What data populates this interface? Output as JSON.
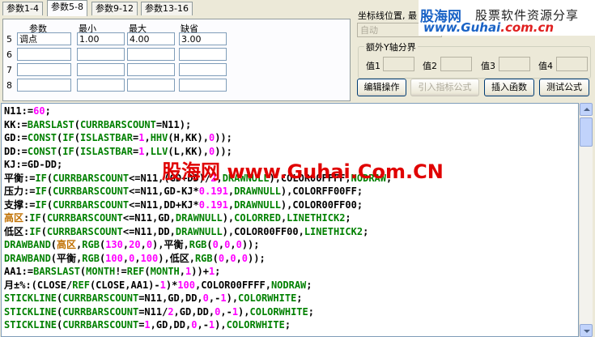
{
  "tabs": [
    "参数1-4",
    "参数5-8",
    "参数9-12",
    "参数13-16"
  ],
  "params": {
    "headers": [
      "参数",
      "最小",
      "最大",
      "缺省"
    ],
    "rows": [
      {
        "num": "5",
        "name": "调点",
        "min": "1.00",
        "max": "4.00",
        "default": "3.00"
      },
      {
        "num": "6",
        "name": "",
        "min": "",
        "max": "",
        "default": ""
      },
      {
        "num": "7",
        "name": "",
        "min": "",
        "max": "",
        "default": ""
      },
      {
        "num": "8",
        "name": "",
        "min": "",
        "max": "",
        "default": ""
      }
    ]
  },
  "coord": {
    "label": "坐标线位置, 最",
    "combo_value": "自动"
  },
  "extra_y": {
    "title": "额外Y轴分界",
    "labels": [
      "值1",
      "值2",
      "值3",
      "值4"
    ]
  },
  "buttons": {
    "edit": "编辑操作",
    "import": "引入指标公式",
    "insert": "插入函数",
    "test": "测试公式"
  },
  "logo": {
    "brand": "股海网",
    "tagline": "股票软件资源分享",
    "url_main": "www.Guhai",
    "url_suffix": ".com.cn"
  },
  "watermark": "股海网 www.Guhai.Com.CN",
  "code_lines": [
    [
      [
        "o",
        "N11:="
      ],
      [
        "n",
        "60"
      ],
      [
        "o",
        ";"
      ]
    ],
    [
      [
        "o",
        "KK:="
      ],
      [
        "k",
        "BARSLAST"
      ],
      [
        "o",
        "("
      ],
      [
        "k",
        "CURRBARSCOUNT"
      ],
      [
        "o",
        "=N11);"
      ]
    ],
    [
      [
        "o",
        "GD:="
      ],
      [
        "k",
        "CONST"
      ],
      [
        "o",
        "("
      ],
      [
        "k",
        "IF"
      ],
      [
        "o",
        "("
      ],
      [
        "k",
        "ISLASTBAR"
      ],
      [
        "o",
        "="
      ],
      [
        "n",
        "1"
      ],
      [
        "o",
        ","
      ],
      [
        "k",
        "HHV"
      ],
      [
        "o",
        "(H,KK),"
      ],
      [
        "n",
        "0"
      ],
      [
        "o",
        "));"
      ]
    ],
    [
      [
        "o",
        "DD:="
      ],
      [
        "k",
        "CONST"
      ],
      [
        "o",
        "("
      ],
      [
        "k",
        "IF"
      ],
      [
        "o",
        "("
      ],
      [
        "k",
        "ISLASTBAR"
      ],
      [
        "o",
        "="
      ],
      [
        "n",
        "1"
      ],
      [
        "o",
        ","
      ],
      [
        "k",
        "LLV"
      ],
      [
        "o",
        "(L,KK),"
      ],
      [
        "n",
        "0"
      ],
      [
        "o",
        "));"
      ]
    ],
    [
      [
        "o",
        "KJ:=GD-DD;"
      ]
    ],
    [
      [
        "o",
        "平衡:="
      ],
      [
        "k",
        "IF"
      ],
      [
        "o",
        "("
      ],
      [
        "k",
        "CURRBARSCOUNT"
      ],
      [
        "o",
        "<=N11,(GD+DD)/"
      ],
      [
        "n",
        "2"
      ],
      [
        "o",
        ","
      ],
      [
        "k",
        "DRAWNULL"
      ],
      [
        "o",
        "),COLOR00FFFF,"
      ],
      [
        "k",
        "NODRAW"
      ],
      [
        "o",
        ";"
      ]
    ],
    [
      [
        "o",
        "压力:="
      ],
      [
        "k",
        "IF"
      ],
      [
        "o",
        "("
      ],
      [
        "k",
        "CURRBARSCOUNT"
      ],
      [
        "o",
        "<=N11,GD-KJ*"
      ],
      [
        "n",
        "0.191"
      ],
      [
        "o",
        ","
      ],
      [
        "k",
        "DRAWNULL"
      ],
      [
        "o",
        "),COLORFF00FF;"
      ]
    ],
    [
      [
        "o",
        "支撑:="
      ],
      [
        "k",
        "IF"
      ],
      [
        "o",
        "("
      ],
      [
        "k",
        "CURRBARSCOUNT"
      ],
      [
        "o",
        "<=N11,DD+KJ*"
      ],
      [
        "n",
        "0.191"
      ],
      [
        "o",
        ","
      ],
      [
        "k",
        "DRAWNULL"
      ],
      [
        "o",
        "),COLOR00FF00;"
      ]
    ],
    [
      [
        "h",
        "高区"
      ],
      [
        "o",
        ":"
      ],
      [
        "k",
        "IF"
      ],
      [
        "o",
        "("
      ],
      [
        "k",
        "CURRBARSCOUNT"
      ],
      [
        "o",
        "<=N11,GD,"
      ],
      [
        "k",
        "DRAWNULL"
      ],
      [
        "o",
        "),"
      ],
      [
        "k",
        "COLORRED"
      ],
      [
        "o",
        ","
      ],
      [
        "k",
        "LINETHICK2"
      ],
      [
        "o",
        ";"
      ]
    ],
    [
      [
        "o",
        "低区:"
      ],
      [
        "k",
        "IF"
      ],
      [
        "o",
        "("
      ],
      [
        "k",
        "CURRBARSCOUNT"
      ],
      [
        "o",
        "<=N11,DD,"
      ],
      [
        "k",
        "DRAWNULL"
      ],
      [
        "o",
        "),COLOR00FF00,"
      ],
      [
        "k",
        "LINETHICK2"
      ],
      [
        "o",
        ";"
      ]
    ],
    [
      [
        "k",
        "DRAWBAND"
      ],
      [
        "o",
        "("
      ],
      [
        "h",
        "高区"
      ],
      [
        "o",
        ","
      ],
      [
        "k",
        "RGB"
      ],
      [
        "o",
        "("
      ],
      [
        "n",
        "130"
      ],
      [
        "o",
        ","
      ],
      [
        "n",
        "20"
      ],
      [
        "o",
        ","
      ],
      [
        "n",
        "0"
      ],
      [
        "o",
        "),平衡,"
      ],
      [
        "k",
        "RGB"
      ],
      [
        "o",
        "("
      ],
      [
        "n",
        "0"
      ],
      [
        "o",
        ","
      ],
      [
        "n",
        "0"
      ],
      [
        "o",
        ","
      ],
      [
        "n",
        "0"
      ],
      [
        "o",
        "));"
      ]
    ],
    [
      [
        "k",
        "DRAWBAND"
      ],
      [
        "o",
        "(平衡,"
      ],
      [
        "k",
        "RGB"
      ],
      [
        "o",
        "("
      ],
      [
        "n",
        "100"
      ],
      [
        "o",
        ","
      ],
      [
        "n",
        "0"
      ],
      [
        "o",
        ","
      ],
      [
        "n",
        "100"
      ],
      [
        "o",
        "),低区,"
      ],
      [
        "k",
        "RGB"
      ],
      [
        "o",
        "("
      ],
      [
        "n",
        "0"
      ],
      [
        "o",
        ","
      ],
      [
        "n",
        "0"
      ],
      [
        "o",
        ","
      ],
      [
        "n",
        "0"
      ],
      [
        "o",
        "));"
      ]
    ],
    [
      [
        "o",
        "AA1:="
      ],
      [
        "k",
        "BARSLAST"
      ],
      [
        "o",
        "("
      ],
      [
        "k",
        "MONTH"
      ],
      [
        "o",
        "!="
      ],
      [
        "k",
        "REF"
      ],
      [
        "o",
        "("
      ],
      [
        "k",
        "MONTH"
      ],
      [
        "o",
        ","
      ],
      [
        "n",
        "1"
      ],
      [
        "o",
        "))+"
      ],
      [
        "n",
        "1"
      ],
      [
        "o",
        ";"
      ]
    ],
    [
      [
        "o",
        "月±%:(CLOSE/"
      ],
      [
        "k",
        "REF"
      ],
      [
        "o",
        "(CLOSE,AA1)-"
      ],
      [
        "n",
        "1"
      ],
      [
        "o",
        ")*"
      ],
      [
        "n",
        "100"
      ],
      [
        "o",
        ",COLOR00FFFF,"
      ],
      [
        "k",
        "NODRAW"
      ],
      [
        "o",
        ";"
      ]
    ],
    [
      [
        "k",
        "STICKLINE"
      ],
      [
        "o",
        "("
      ],
      [
        "k",
        "CURRBARSCOUNT"
      ],
      [
        "o",
        "=N11,GD,DD,"
      ],
      [
        "n",
        "0"
      ],
      [
        "o",
        ",-"
      ],
      [
        "n",
        "1"
      ],
      [
        "o",
        "),"
      ],
      [
        "k",
        "COLORWHITE"
      ],
      [
        "o",
        ";"
      ]
    ],
    [
      [
        "k",
        "STICKLINE"
      ],
      [
        "o",
        "("
      ],
      [
        "k",
        "CURRBARSCOUNT"
      ],
      [
        "o",
        "=N11/"
      ],
      [
        "n",
        "2"
      ],
      [
        "o",
        ",GD,DD,"
      ],
      [
        "n",
        "0"
      ],
      [
        "o",
        ",-"
      ],
      [
        "n",
        "1"
      ],
      [
        "o",
        "),"
      ],
      [
        "k",
        "COLORWHITE"
      ],
      [
        "o",
        ";"
      ]
    ],
    [
      [
        "k",
        "STICKLINE"
      ],
      [
        "o",
        "("
      ],
      [
        "k",
        "CURRBARSCOUNT"
      ],
      [
        "o",
        "="
      ],
      [
        "n",
        "1"
      ],
      [
        "o",
        ",GD,DD,"
      ],
      [
        "n",
        "0"
      ],
      [
        "o",
        ",-"
      ],
      [
        "n",
        "1"
      ],
      [
        "o",
        "),"
      ],
      [
        "k",
        "COLORWHITE"
      ],
      [
        "o",
        ";"
      ]
    ]
  ],
  "colors": {
    "keyword": "#008000",
    "number": "#ff00ff",
    "highlight": "#c07000",
    "watermark": "#e00000"
  }
}
